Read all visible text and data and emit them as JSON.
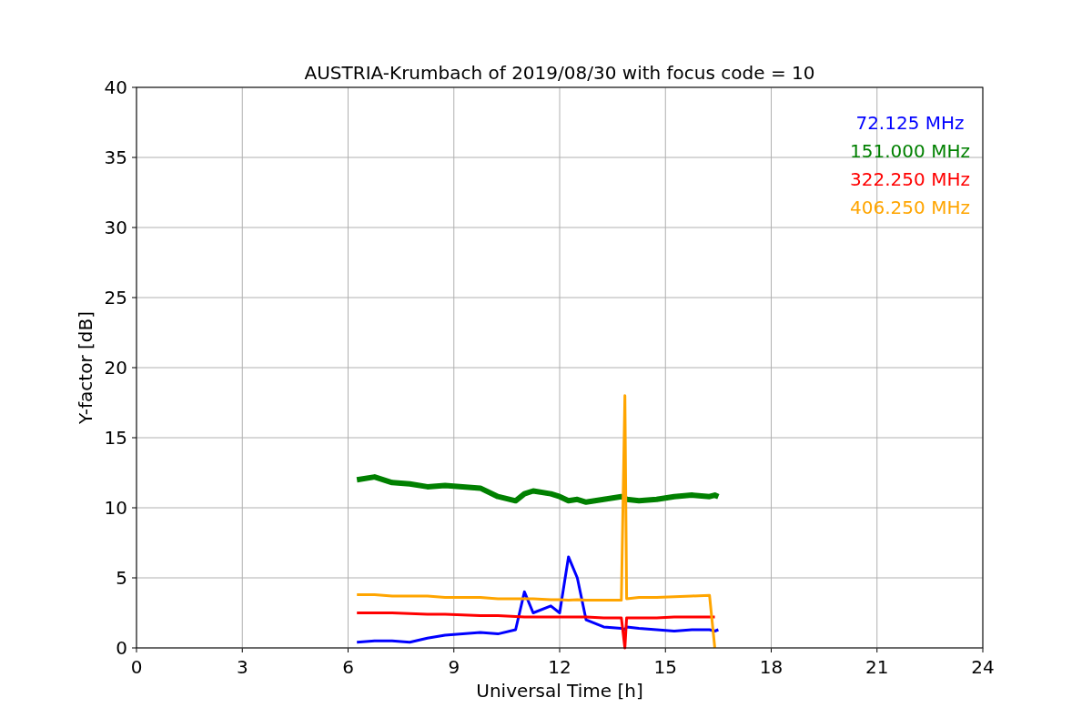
{
  "chart_data": {
    "type": "line",
    "grid": true,
    "title": "AUSTRIA-Krumbach of 2019/08/30 with focus code = 10",
    "xlabel": "Universal Time [h]",
    "ylabel": "Y-factor [dB]",
    "xlim": [
      0,
      24
    ],
    "ylim": [
      0,
      40
    ],
    "xticks": [
      0,
      3,
      6,
      9,
      12,
      15,
      18,
      21,
      24
    ],
    "yticks": [
      0,
      5,
      10,
      15,
      20,
      25,
      30,
      35,
      40
    ],
    "x": [
      6.25,
      6.75,
      7.25,
      7.75,
      8.25,
      8.75,
      9.25,
      9.75,
      10.25,
      10.75,
      11.0,
      11.25,
      11.75,
      12.0,
      12.25,
      12.5,
      12.75,
      13.25,
      13.75,
      13.85,
      13.9,
      14.25,
      14.75,
      15.25,
      15.75,
      16.25,
      16.4,
      16.5
    ],
    "series": [
      {
        "name": "72.125 MHz",
        "color": "#0000ff",
        "values": [
          0.4,
          0.5,
          0.5,
          0.4,
          0.7,
          0.9,
          1.0,
          1.1,
          1.0,
          1.3,
          4.0,
          2.5,
          3.0,
          2.5,
          6.5,
          5.0,
          2.0,
          1.5,
          1.4,
          1.3,
          1.5,
          1.4,
          1.3,
          1.2,
          1.3,
          1.3,
          1.2,
          1.3
        ]
      },
      {
        "name": "151.000 MHz",
        "color": "#008000",
        "values": [
          12.0,
          12.2,
          11.8,
          11.7,
          11.5,
          11.6,
          11.5,
          11.4,
          10.8,
          10.5,
          11.0,
          11.2,
          11.0,
          10.8,
          10.5,
          10.6,
          10.4,
          10.6,
          10.8,
          10.7,
          10.6,
          10.5,
          10.6,
          10.8,
          10.9,
          10.8,
          10.9,
          10.8
        ]
      },
      {
        "name": "322.250 MHz",
        "color": "#ff0000",
        "values": [
          2.5,
          2.5,
          2.5,
          2.45,
          2.4,
          2.4,
          2.35,
          2.3,
          2.3,
          2.25,
          2.2,
          2.2,
          2.2,
          2.2,
          2.2,
          2.2,
          2.2,
          2.15,
          2.15,
          0,
          2.15,
          2.15,
          2.15,
          2.2,
          2.2,
          2.2,
          2.2,
          null
        ]
      },
      {
        "name": "406.250 MHz",
        "color": "#ffa500",
        "values": [
          3.8,
          3.8,
          3.7,
          3.7,
          3.7,
          3.6,
          3.6,
          3.6,
          3.5,
          3.5,
          3.5,
          3.5,
          3.45,
          3.45,
          3.4,
          3.45,
          3.4,
          3.4,
          3.4,
          18.0,
          3.5,
          3.6,
          3.6,
          3.65,
          3.7,
          3.75,
          0,
          null
        ]
      }
    ]
  }
}
